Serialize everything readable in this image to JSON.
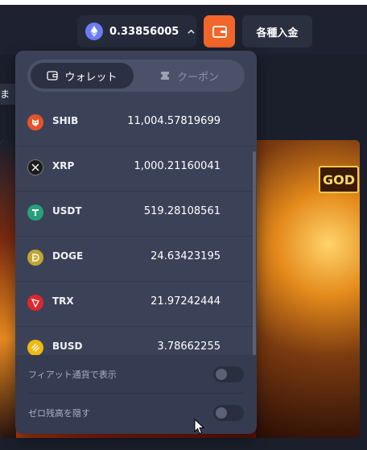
{
  "header": {
    "balance": "0.33856005",
    "deposit_label": "各種入金"
  },
  "background": {
    "left_snippet": "まが",
    "badge_text": "GOD"
  },
  "dropdown": {
    "tabs": [
      {
        "label": "ウォレット",
        "active": true
      },
      {
        "label": "クーポン",
        "active": false
      }
    ],
    "coins": [
      {
        "symbol": "SHIB",
        "amount": "11,004.57819699",
        "icon": "shib-icon",
        "color": "#e8522a"
      },
      {
        "symbol": "XRP",
        "amount": "1,000.21160041",
        "icon": "xrp-icon",
        "color": "#1b1b1b"
      },
      {
        "symbol": "USDT",
        "amount": "519.28108561",
        "icon": "usdt-icon",
        "color": "#26a17b"
      },
      {
        "symbol": "DOGE",
        "amount": "24.63423195",
        "icon": "doge-icon",
        "color": "#c2a633"
      },
      {
        "symbol": "TRX",
        "amount": "21.97242444",
        "icon": "trx-icon",
        "color": "#e0262d"
      },
      {
        "symbol": "BUSD",
        "amount": "3.78662255",
        "icon": "busd-icon",
        "color": "#f0b90b"
      }
    ],
    "settings": [
      {
        "label": "フィアット通貨で表示",
        "on": false
      },
      {
        "label": "ゼロ残高を隠す",
        "on": false
      }
    ]
  }
}
